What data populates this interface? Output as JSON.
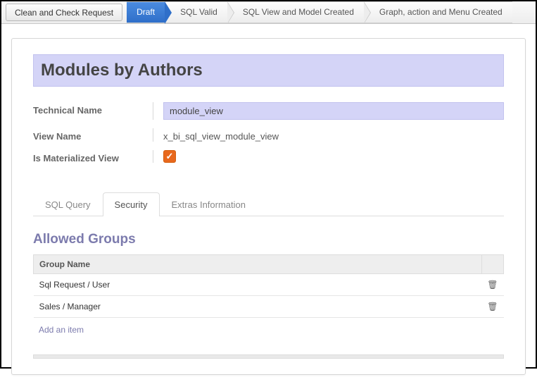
{
  "toolbar": {
    "clean_check": "Clean and Check Request"
  },
  "stages": [
    "Draft",
    "SQL Valid",
    "SQL View and Model Created",
    "Graph, action and Menu Created"
  ],
  "active_stage": 0,
  "title": "Modules by Authors",
  "form": {
    "tech_name_label": "Technical Name",
    "tech_name_value": "module_view",
    "view_name_label": "View Name",
    "view_name_value": "x_bi_sql_view_module_view",
    "materialized_label": "Is Materialized View",
    "materialized_checked": true
  },
  "tabs": [
    "SQL Query",
    "Security",
    "Extras Information"
  ],
  "active_tab": 1,
  "section_title": "Allowed Groups",
  "table": {
    "col": "Group Name",
    "rows": [
      "Sql Request / User",
      "Sales / Manager"
    ]
  },
  "add_item": "Add an item"
}
